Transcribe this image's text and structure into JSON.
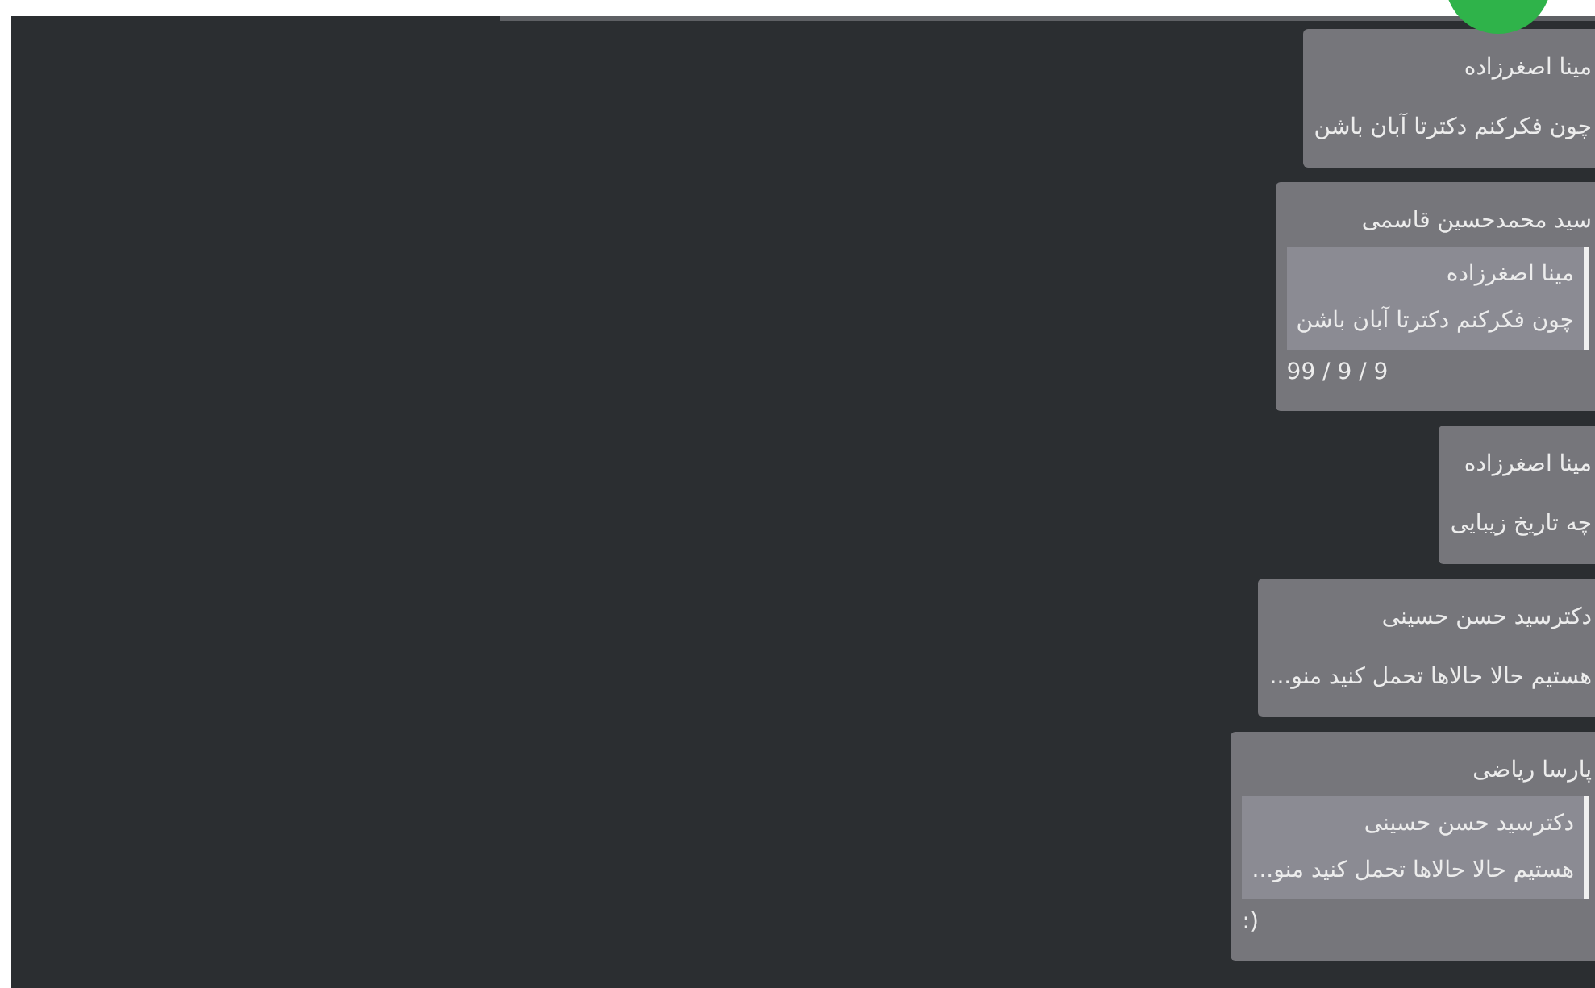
{
  "messages": [
    {
      "sender": "مینا اصغرزاده",
      "text": "چون فکرکنم دکترتا آبان باشن"
    },
    {
      "sender": "سید محمدحسین قاسمی",
      "reply": {
        "sender": "مینا اصغرزاده",
        "text": "چون فکرکنم دکترتا آبان باشن"
      },
      "text": "99 / 9 / 9"
    },
    {
      "sender": "مینا اصغرزاده",
      "text": "چه تاریخ زیبایی"
    },
    {
      "sender": "دکترسید حسن حسینی",
      "text": "هستیم حالا حالاها تحمل کنید منو..."
    },
    {
      "sender": "پارسا ریاضی",
      "reply": {
        "sender": "دکترسید حسن حسینی",
        "text": "هستیم حالا حالاها تحمل کنید منو..."
      },
      "text": ":)"
    }
  ]
}
